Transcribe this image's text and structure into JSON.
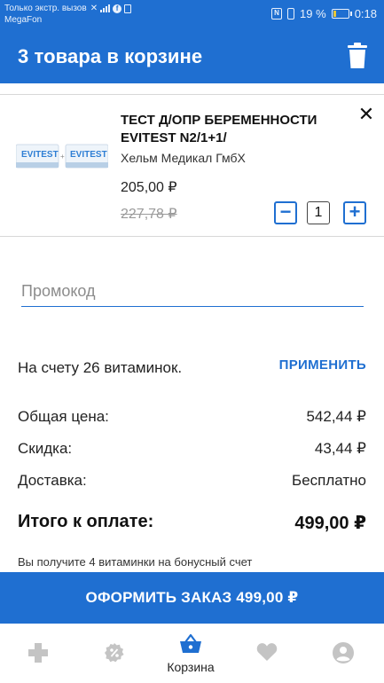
{
  "status_bar": {
    "notice": "Только экстр. вызов",
    "carrier": "MegaFon",
    "battery": "19 %",
    "time": "0:18",
    "nfc": "N"
  },
  "header": {
    "title": "3 товара в корзине",
    "trash_icon": "trash-icon"
  },
  "cart_item": {
    "name": "ТЕСТ Д/ОПР БЕРЕМЕННОСТИ EVITEST N2/1+1/",
    "manufacturer": "Хельм Медикал ГмбХ",
    "price": "205,00 ₽",
    "old_price": "227,78 ₽",
    "quantity": "1",
    "remove_symbol": "✕",
    "minus_symbol": "−",
    "plus_symbol": "+",
    "image_brand": "EVITEST"
  },
  "promo": {
    "placeholder": "Промокод",
    "value": ""
  },
  "bonus_account": {
    "text": "На счету 26 витаминок.",
    "apply_label": "ПРИМЕНИТЬ"
  },
  "summary": {
    "total_price_label": "Общая цена:",
    "total_price_value": "542,44 ₽",
    "discount_label": "Скидка:",
    "discount_value": "43,44 ₽",
    "delivery_label": "Доставка:",
    "delivery_value": "Бесплатно",
    "to_pay_label": "Итого к оплате:",
    "to_pay_value": "499,00 ₽",
    "bonus_note": "Вы получите 4 витаминки на бонусный счет"
  },
  "checkout": {
    "label": "ОФОРМИТЬ ЗАКАЗ 499,00 ₽"
  },
  "bottom_nav": {
    "items": [
      {
        "icon": "pharmacy-cross-icon",
        "label": ""
      },
      {
        "icon": "discount-badge-icon",
        "label": ""
      },
      {
        "icon": "basket-icon",
        "label": "Корзина",
        "active": true
      },
      {
        "icon": "heart-icon",
        "label": ""
      },
      {
        "icon": "profile-icon",
        "label": ""
      }
    ]
  },
  "colors": {
    "accent": "#1f6fd1",
    "inactive_icon": "#c4c4c4",
    "battery": "#e7c73a"
  }
}
